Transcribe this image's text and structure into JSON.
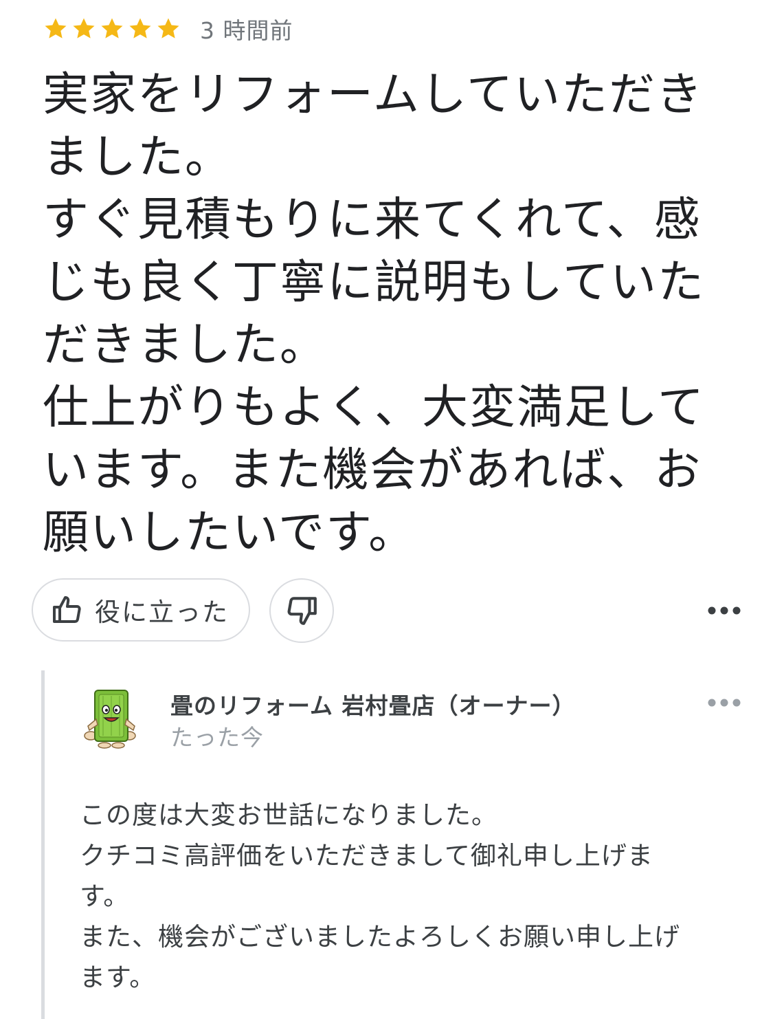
{
  "review": {
    "rating": 5,
    "max_rating": 5,
    "star_color": "#f5b816",
    "timestamp": "3 時間前",
    "body_lines": [
      "実家をリフォームしていただき",
      "ました。",
      "すぐ見積もりに来てくれて、感",
      "じも良く丁寧に説明もしていた",
      "だきました。",
      "仕上がりもよく、大変満足して",
      "います。また機会があれば、お",
      "願いしたいです。"
    ]
  },
  "actions": {
    "helpful_label": "役に立った",
    "helpful_icon": "thumbs-up-icon",
    "unhelpful_icon": "thumbs-down-icon",
    "more_icon": "more-horiz-icon"
  },
  "owner_reply": {
    "name": "畳のリフォーム 岩村畳店（オーナー）",
    "time": "たった今",
    "avatar_icon": "tatami-mascot-icon",
    "body_lines": [
      "この度は大変お世話になりました。",
      "クチコミ高評価をいただきまして御礼申し上げま",
      "す。",
      "また、機会がございましたよろしくお願い申し上げ",
      "ます。"
    ]
  }
}
